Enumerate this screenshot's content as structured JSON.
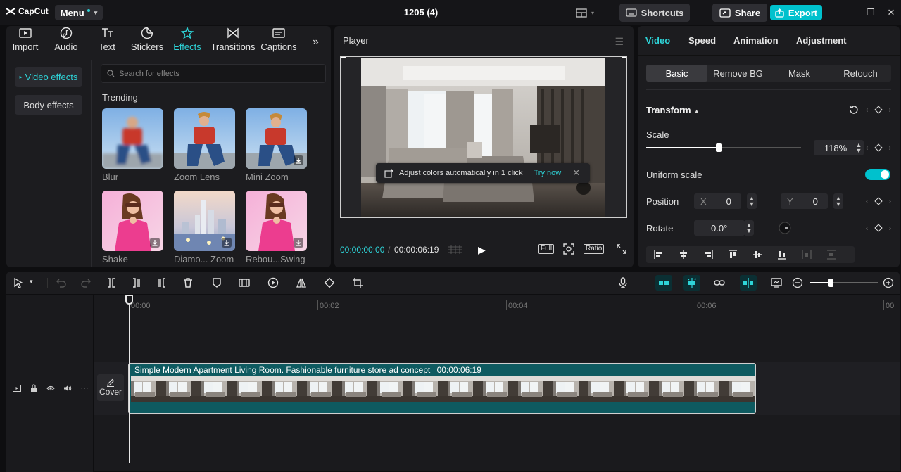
{
  "app": {
    "logo": "CapCut",
    "menu_label": "Menu",
    "project_title": "1205 (4)",
    "shortcuts_label": "Shortcuts",
    "share_label": "Share",
    "export_label": "Export",
    "accent_color": "#00c1cd"
  },
  "media_tabs": [
    {
      "label": "Import",
      "icon": "import-icon"
    },
    {
      "label": "Audio",
      "icon": "audio-icon"
    },
    {
      "label": "Text",
      "icon": "text-icon"
    },
    {
      "label": "Stickers",
      "icon": "stickers-icon"
    },
    {
      "label": "Effects",
      "icon": "effects-icon",
      "active": true
    },
    {
      "label": "Transitions",
      "icon": "transitions-icon"
    },
    {
      "label": "Captions",
      "icon": "captions-icon"
    }
  ],
  "effects": {
    "sidebar": [
      "Video effects",
      "Body effects"
    ],
    "search_placeholder": "Search for effects",
    "section": "Trending",
    "items": [
      {
        "label": "Blur",
        "download": false
      },
      {
        "label": "Zoom Lens",
        "download": false
      },
      {
        "label": "Mini Zoom",
        "download": true
      },
      {
        "label": "Shake",
        "download": true
      },
      {
        "label": "Diamo... Zoom",
        "download": true
      },
      {
        "label": "Rebou...Swing",
        "download": true
      }
    ]
  },
  "player": {
    "title": "Player",
    "toast_text": "Adjust colors automatically in 1 click",
    "toast_action": "Try now",
    "current_time": "00:00:00:00",
    "time_sep": "/",
    "duration": "00:00:06:19",
    "full_label": "Full",
    "ratio_label": "Ratio"
  },
  "properties": {
    "tabs": [
      "Video",
      "Speed",
      "Animation",
      "Adjustment"
    ],
    "subtabs": [
      "Basic",
      "Remove BG",
      "Mask",
      "Retouch"
    ],
    "transform_title": "Transform",
    "scale_label": "Scale",
    "scale_value": "118%",
    "scale_fraction": 0.47,
    "uniform_scale_label": "Uniform scale",
    "uniform_scale_on": true,
    "position_label": "Position",
    "pos_x_label": "X",
    "pos_x": "0",
    "pos_y_label": "Y",
    "pos_y": "0",
    "rotate_label": "Rotate",
    "rotate_value": "0.0°"
  },
  "timeline": {
    "ticks": [
      "00:00",
      "00:02",
      "00:04",
      "00:06",
      "00"
    ],
    "clip_title": "Simple Modern Apartment Living Room. Fashionable furniture store ad concept",
    "clip_duration": "00:00:06:19",
    "cover_label": "Cover",
    "zoom_fraction": 0.3
  }
}
